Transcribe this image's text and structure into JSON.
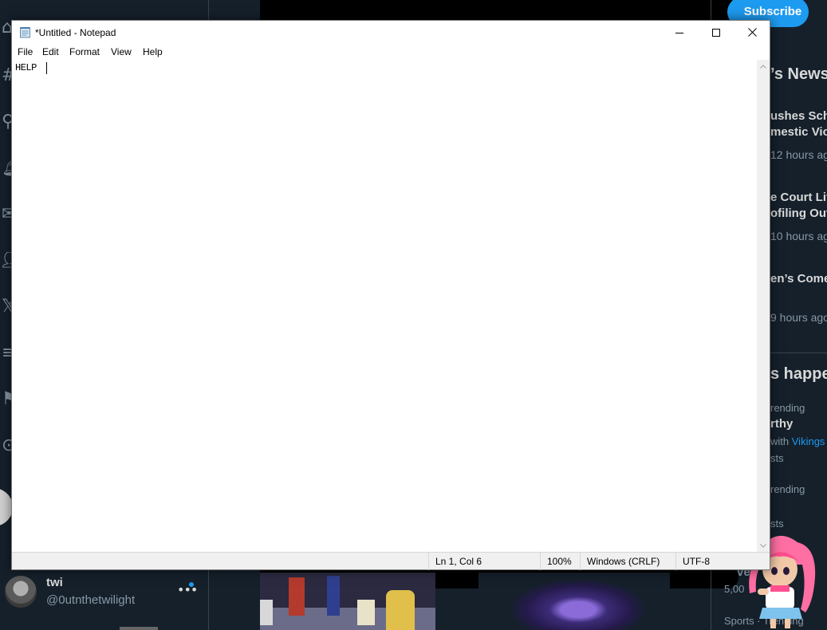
{
  "notepad": {
    "title": "*Untitled - Notepad",
    "menu": [
      "File",
      "Edit",
      "Format",
      "View",
      "Help"
    ],
    "content": "HELP ",
    "status": {
      "position": "Ln 1, Col 6",
      "zoom": "100%",
      "line_ending": "Windows (CRLF)",
      "encoding": "UTF-8"
    }
  },
  "background": {
    "subscribe_label": "Subscribe",
    "news_header": "’s News",
    "news": [
      {
        "title_line1": "ushes Sch",
        "title_line2": "mestic Vio",
        "time": "12 hours ago"
      },
      {
        "title_line1": "e Court Lif",
        "title_line2": "ofiling Out",
        "time": "10 hours ago"
      },
      {
        "title_line1": "en’s Come",
        "title_line2": "",
        "time": "9 hours ago"
      }
    ],
    "happening_header": "s happe",
    "trend1": {
      "category": "rending",
      "title": "rthy",
      "with_prefix": "with",
      "with_link": "Vikings",
      "count": "sts"
    },
    "trend2": {
      "category": "rending",
      "count": "sts"
    },
    "trend3": {
      "label": "ve",
      "count": "5,00"
    },
    "trend4": {
      "category": "Sports · Trending"
    },
    "profile": {
      "name": "twi",
      "handle": "@0utnthetwilight"
    }
  },
  "colors": {
    "twitter_bg": "#15202b",
    "accent": "#1d9bf0",
    "status_bar": "#f0f0f0"
  }
}
